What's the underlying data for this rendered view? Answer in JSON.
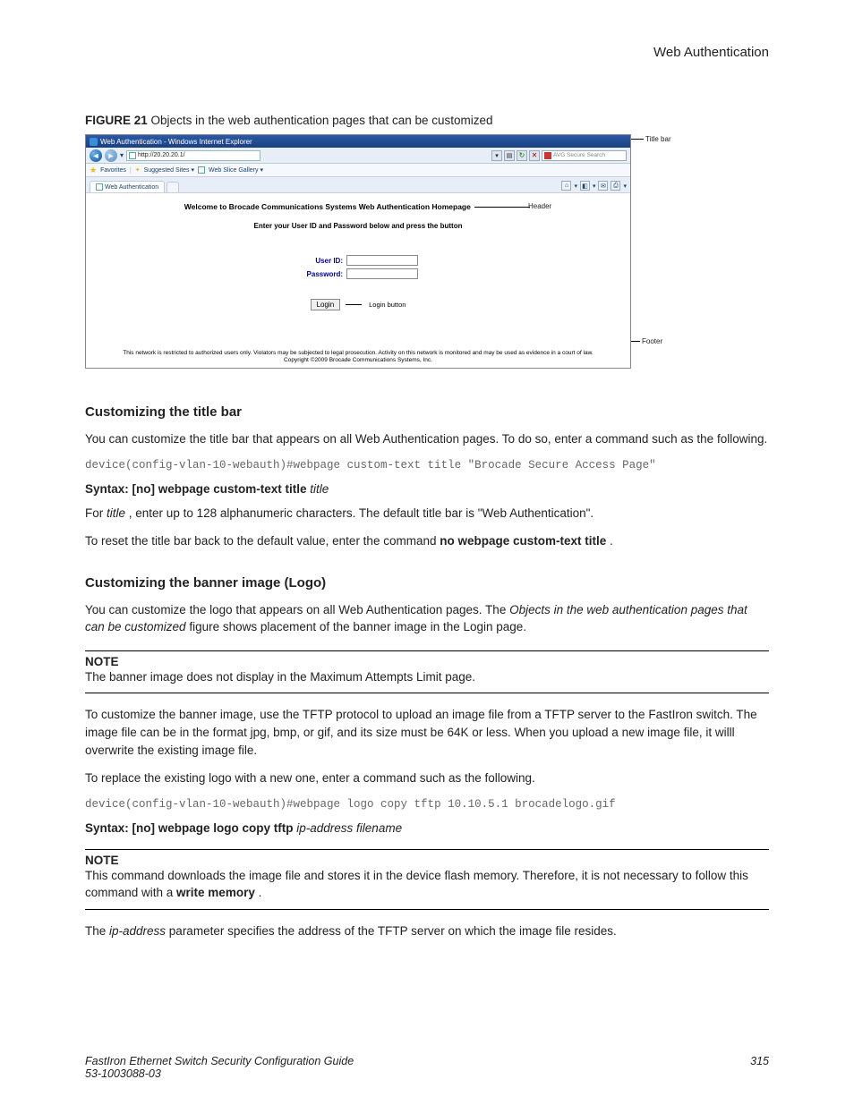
{
  "runningHead": "Web Authentication",
  "figure": {
    "label": "FIGURE 21",
    "caption": "Objects in the web authentication pages that can be customized",
    "browser": {
      "windowTitle": "Web Authentication - Windows Internet Explorer",
      "url": "http://20.20.20.1/",
      "searchPlaceholder": "AVG Secure Search",
      "favoritesLabel": "Favorites",
      "suggestedSites": "Suggested Sites ▾",
      "webSlice": "Web Slice Gallery ▾",
      "tabTitle": "Web Authentication",
      "header": "Welcome to Brocade Communications Systems Web Authentication Homepage",
      "subHeader": "Enter your User ID and Password below and press the button",
      "userIdLabel": "User ID:",
      "passwordLabel": "Password:",
      "loginBtn": "Login",
      "footerLine1": "This network is restricted to authorized users only. Violators may be subjected to legal prosecution. Activity on this network is monitored and may be used as evidence in a court of law.",
      "footerLine2": "Copyright ©2009 Brocade Communications Systems, Inc."
    },
    "callouts": {
      "titleBar": "Title bar",
      "header": "Header",
      "loginButton": "Login button",
      "footer": "Footer"
    }
  },
  "sec1": {
    "title": "Customizing the title bar",
    "p1": "You can customize the title bar that appears on all Web Authentication pages. To do so, enter a command such as the following.",
    "code": "device(config-vlan-10-webauth)#webpage custom-text title \"Brocade Secure Access Page\"",
    "syntaxPrefix": "Syntax: [no] webpage custom-text title",
    "syntaxVar": "title",
    "p2a": "For ",
    "p2var": "title",
    "p2b": " , enter up to 128 alphanumeric characters. The default title bar is \"Web Authentication\".",
    "p3a": "To reset the title bar back to the default value, enter the command ",
    "p3b": "no webpage custom-text title",
    "p3c": " ."
  },
  "sec2": {
    "title": "Customizing the banner image (Logo)",
    "p1a": "You can customize the logo that appears on all Web Authentication pages. The ",
    "p1i": "Objects in the web authentication pages that can be customized",
    "p1b": " figure shows placement of the banner image in the Login page.",
    "noteHead": "NOTE",
    "note1": "The banner image does not display in the Maximum Attempts Limit page.",
    "p2": "To customize the banner image, use the TFTP protocol to upload an image file from a TFTP server to the FastIron switch. The image file can be in the format jpg, bmp, or gif, and its size must be 64K or less. When you upload a new image file, it willl overwrite the existing image file.",
    "p3": "To replace the existing logo with a new one, enter a command such as the following.",
    "code": "device(config-vlan-10-webauth)#webpage logo copy tftp 10.10.5.1 brocadelogo.gif",
    "syntaxPrefix": "Syntax: [no] webpage logo copy tftp",
    "syntaxVar": "ip-address filename",
    "note2a": "This command downloads the image file and stores it in the device flash memory. Therefore, it is not necessary to follow this command with a ",
    "note2b": "write memory",
    "note2c": " .",
    "p4a": "The ",
    "p4i": "ip-address",
    "p4b": " parameter specifies the address of the TFTP server on which the image file resides."
  },
  "footer": {
    "left1": "FastIron Ethernet Switch Security Configuration Guide",
    "left2": "53-1003088-03",
    "right": "315"
  }
}
